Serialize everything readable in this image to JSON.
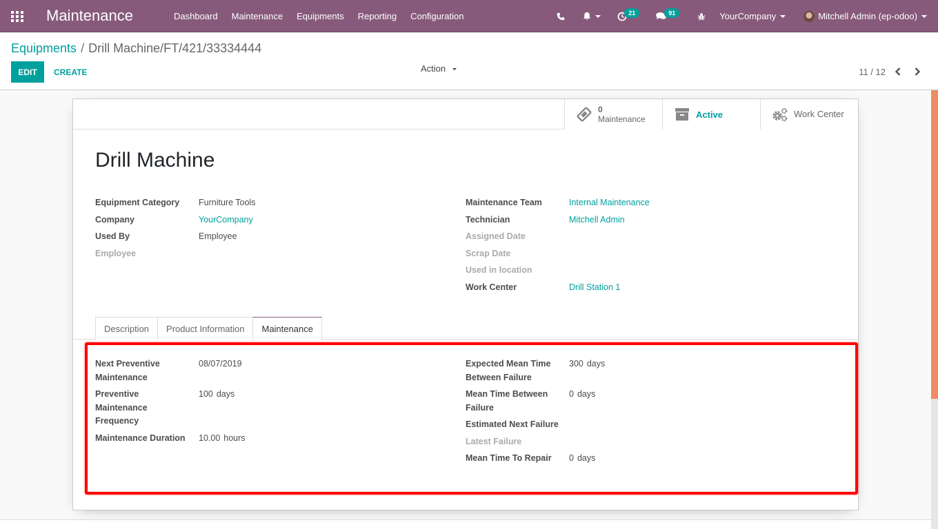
{
  "navbar": {
    "app_title": "Maintenance",
    "menu": [
      "Dashboard",
      "Maintenance",
      "Equipments",
      "Reporting",
      "Configuration"
    ],
    "activity_count": "21",
    "messages_count": "91",
    "company": "YourCompany",
    "user": "Mitchell Admin (ep-odoo)"
  },
  "control_panel": {
    "breadcrumb_parent": "Equipments",
    "breadcrumb_separator": "/",
    "breadcrumb_current": "Drill Machine/FT/421/33334444",
    "edit_label": "EDIT",
    "create_label": "CREATE",
    "action_label": "Action",
    "pager": "11 / 12"
  },
  "smart_buttons": {
    "maintenance_count": "0",
    "maintenance_label": "Maintenance",
    "active_label": "Active",
    "work_center_label": "Work Center"
  },
  "record": {
    "name": "Drill Machine",
    "left_fields": [
      {
        "label": "Equipment Category",
        "value": "Furniture Tools"
      },
      {
        "label": "Company",
        "value": "YourCompany"
      },
      {
        "label": "Used By",
        "value": "Employee"
      },
      {
        "label": "Employee",
        "value": ""
      }
    ],
    "right_fields": [
      {
        "label": "Maintenance Team",
        "value": "Internal Maintenance"
      },
      {
        "label": "Technician",
        "value": "Mitchell Admin"
      },
      {
        "label": "Assigned Date",
        "value": ""
      },
      {
        "label": "Scrap Date",
        "value": ""
      },
      {
        "label": "Used in location",
        "value": ""
      },
      {
        "label": "Work Center",
        "value": "Drill Station 1"
      }
    ]
  },
  "tabs": [
    "Description",
    "Product Information",
    "Maintenance"
  ],
  "active_tab": "Maintenance",
  "maintenance_tab": {
    "left": [
      {
        "label": "Next Preventive Maintenance",
        "value": "08/07/2019",
        "unit": ""
      },
      {
        "label": "Preventive Maintenance Frequency",
        "value": "100",
        "unit": "days"
      },
      {
        "label": "Maintenance Duration",
        "value": "10.00",
        "unit": "hours"
      }
    ],
    "right": [
      {
        "label": "Expected Mean Time Between Failure",
        "value": "300",
        "unit": "days"
      },
      {
        "label": "Mean Time Between Failure",
        "value": "0",
        "unit": "days"
      },
      {
        "label": "Estimated Next Failure",
        "value": "",
        "unit": ""
      },
      {
        "label": "Latest Failure",
        "value": "",
        "unit": ""
      },
      {
        "label": "Mean Time To Repair",
        "value": "0",
        "unit": "days"
      }
    ]
  },
  "colors": {
    "navbar": "#875a7b",
    "accent": "#00a09d",
    "highlight": "#ff0000",
    "scrollbar_thumb": "#ef8c63"
  }
}
